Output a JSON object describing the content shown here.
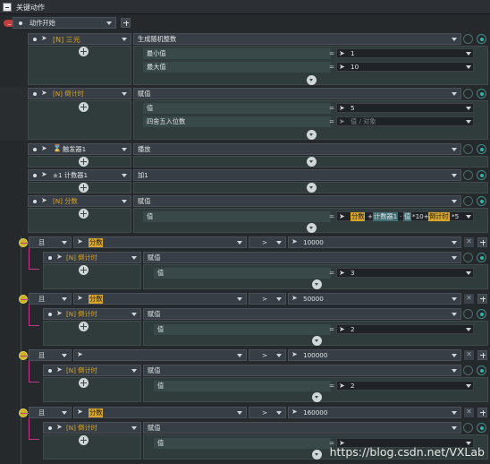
{
  "header": {
    "title": "关键动作"
  },
  "root": {
    "label": "动作开始"
  },
  "actions": [
    {
      "name": "[N] 三元",
      "action": "生成随机整数",
      "params": [
        {
          "label": "最小值",
          "value": "1"
        },
        {
          "label": "最大值",
          "value": "10"
        }
      ]
    },
    {
      "name": "[N] 倒计时",
      "action": "赋值",
      "params": [
        {
          "label": "值",
          "value": "5"
        },
        {
          "label": "四舍五入位数",
          "value": "值 / 对象"
        }
      ]
    },
    {
      "name": "触发器1",
      "action": "播放"
    },
    {
      "name": "±1 计数器1",
      "action": "加1"
    },
    {
      "name": "[N] 分数",
      "action": "赋值",
      "expr": {
        "label": "值",
        "tokens": [
          "分数",
          "+",
          "计数器1",
          "·",
          "值",
          "*10+",
          "倒计时",
          "*5"
        ]
      }
    }
  ],
  "conditions": [
    {
      "logic": "且",
      "var": "分数",
      "op": ">",
      "value": "10000",
      "target": "[N] 倒计时",
      "action": "赋值",
      "param_label": "值",
      "param_value": "3"
    },
    {
      "logic": "且",
      "var": "分数",
      "op": ">",
      "value": "50000",
      "target": "[N] 倒计时",
      "action": "赋值",
      "param_label": "值",
      "param_value": "2"
    },
    {
      "logic": "且",
      "var": "",
      "op": ">",
      "value": "100000",
      "target": "[N] 倒计时",
      "action": "赋值",
      "param_label": "值",
      "param_value": "2"
    },
    {
      "logic": "且",
      "var": "分数",
      "op": ">",
      "value": "160000",
      "target": "[N] 倒计时",
      "action": "赋值",
      "param_label": "值",
      "param_value": ""
    }
  ],
  "equals": "=",
  "watermark": "https://blog.csdn.net/VXLab"
}
